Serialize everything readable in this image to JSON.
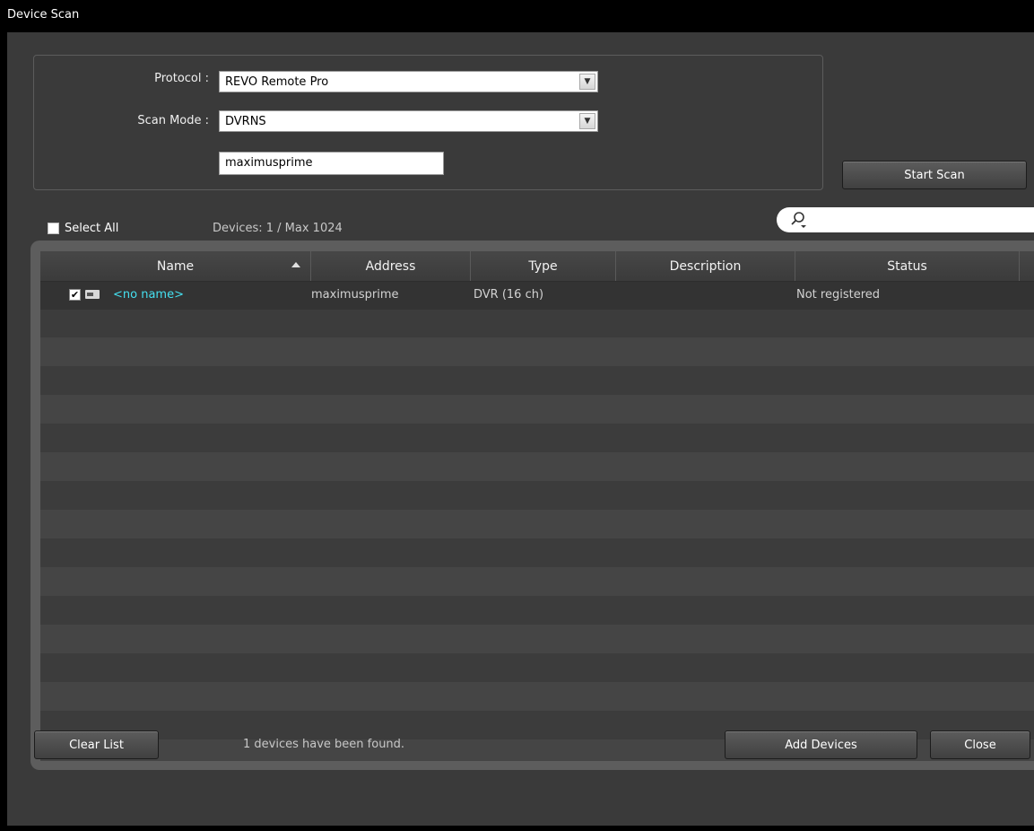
{
  "window": {
    "title": "Device Scan"
  },
  "settings": {
    "protocol_label": "Protocol :",
    "protocol_value": "REVO Remote Pro",
    "scan_mode_label": "Scan Mode :",
    "scan_mode_value": "DVRNS",
    "host_value": "maximusprime"
  },
  "actions": {
    "start_scan": "Start Scan"
  },
  "list_toolbar": {
    "select_all": "Select All",
    "device_count": "Devices: 1 / Max 1024",
    "search_value": ""
  },
  "table": {
    "columns": [
      "Name",
      "Address",
      "Type",
      "Description",
      "Status"
    ],
    "sort_column": "Name",
    "rows": [
      {
        "checked": true,
        "name": "<no name>",
        "address": "maximusprime",
        "type": "DVR (16 ch)",
        "description": "",
        "status": "Not registered"
      }
    ]
  },
  "footer": {
    "clear_list": "Clear List",
    "found_text": "1 devices have been found.",
    "add_devices": "Add Devices",
    "close": "Close"
  },
  "colors": {
    "name_link": "#45e0f0",
    "background": "#3a3a3a"
  }
}
